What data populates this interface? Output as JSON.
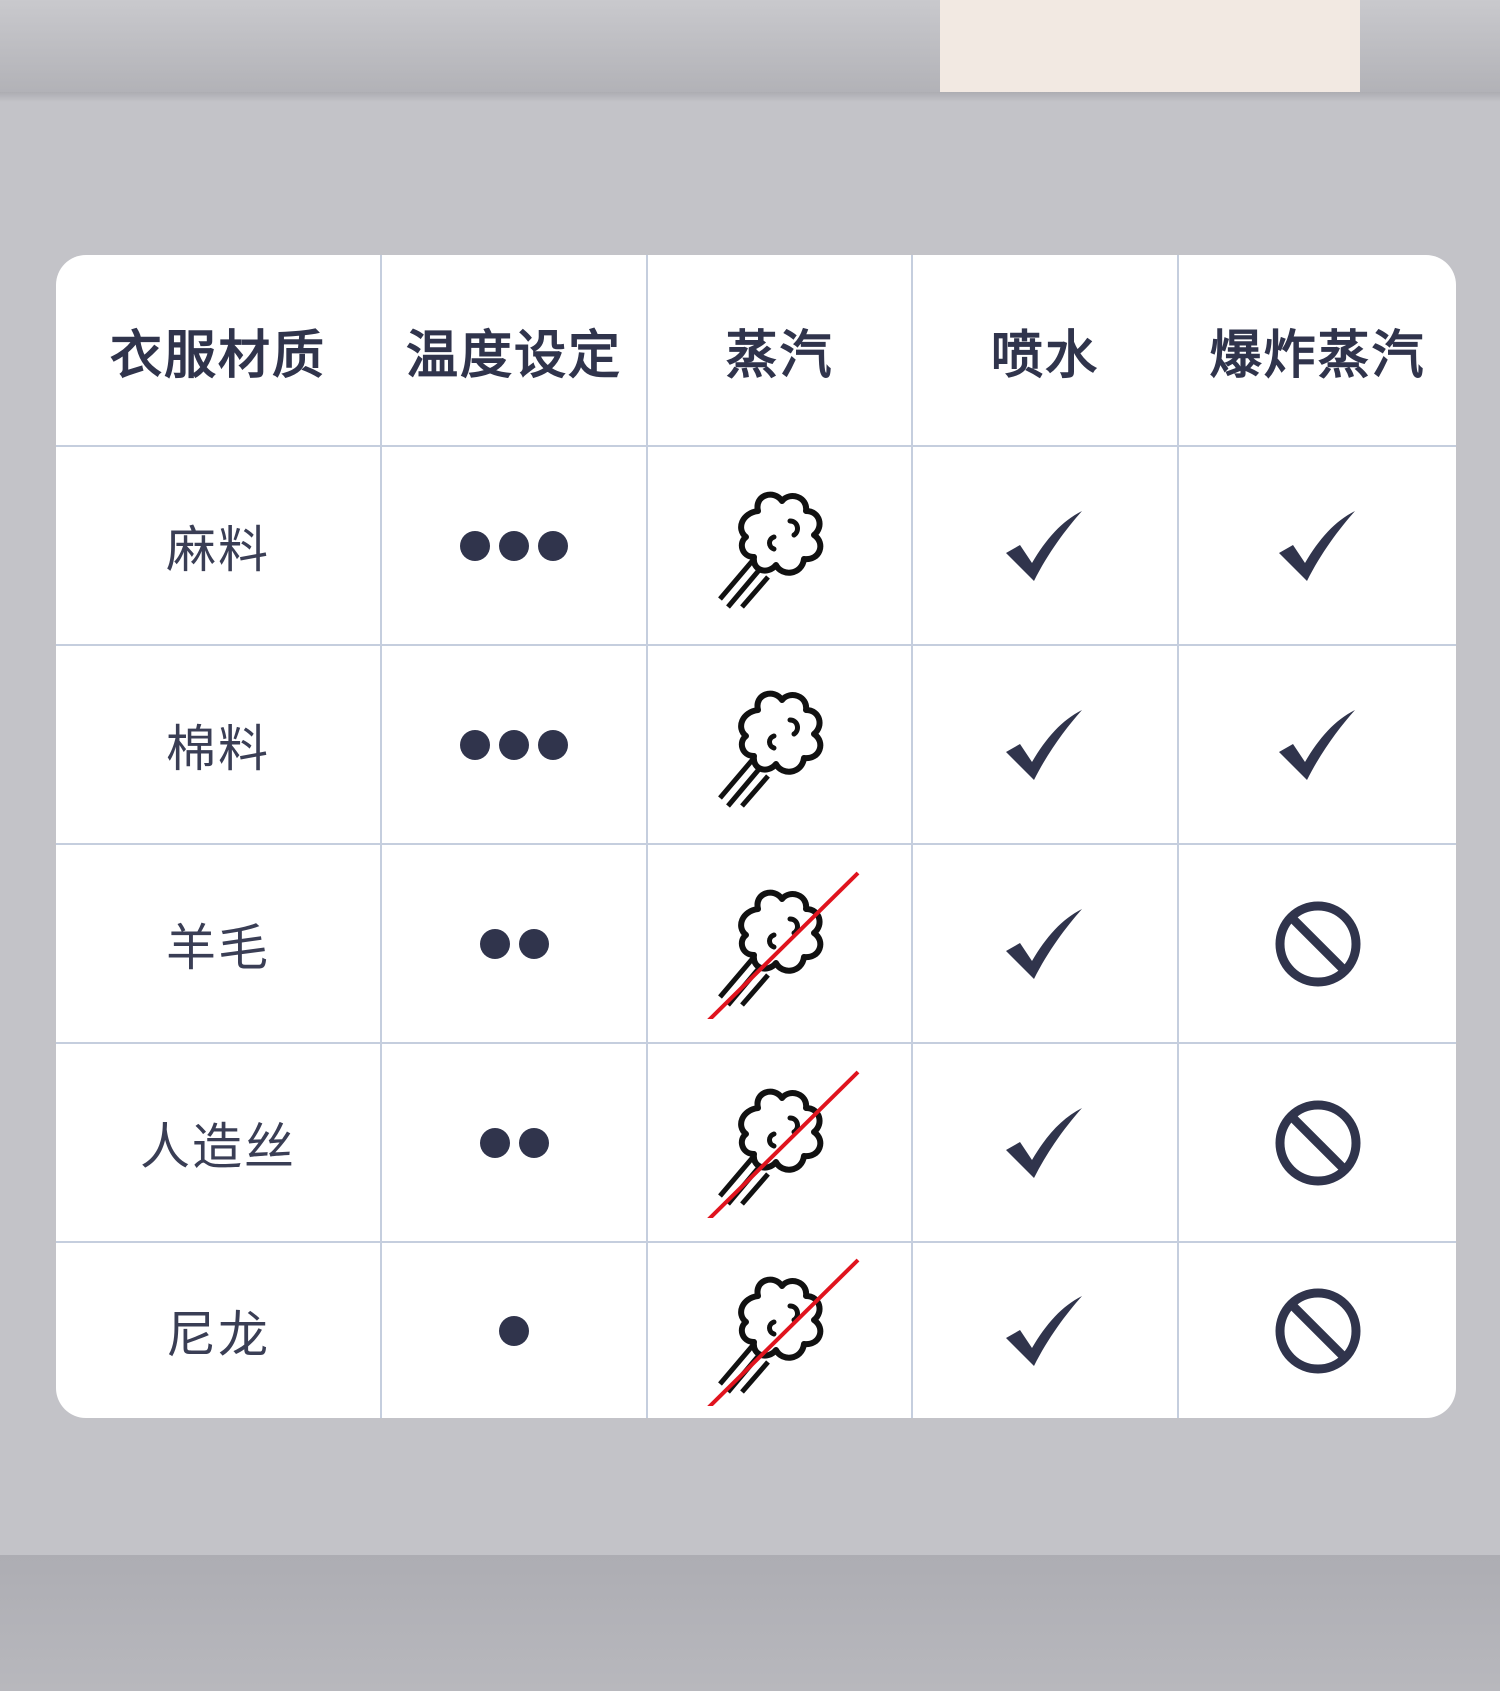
{
  "table": {
    "headers": [
      "衣服材质",
      "温度设定",
      "蒸汽",
      "喷水",
      "爆炸蒸汽"
    ],
    "rows": [
      {
        "material": "麻料",
        "temperature_dots": 3,
        "steam": "steam-icon",
        "spray": "check-icon",
        "burst_steam": "check-icon"
      },
      {
        "material": "棉料",
        "temperature_dots": 3,
        "steam": "steam-icon",
        "spray": "check-icon",
        "burst_steam": "check-icon"
      },
      {
        "material": "羊毛",
        "temperature_dots": 2,
        "steam": "steam-disabled-icon",
        "spray": "check-icon",
        "burst_steam": "prohibited-icon"
      },
      {
        "material": "人造丝",
        "temperature_dots": 2,
        "steam": "steam-disabled-icon",
        "spray": "check-icon",
        "burst_steam": "prohibited-icon"
      },
      {
        "material": "尼龙",
        "temperature_dots": 1,
        "steam": "steam-disabled-icon",
        "spray": "check-icon",
        "burst_steam": "prohibited-icon"
      }
    ]
  },
  "colors": {
    "background": "#c3c3c8",
    "card": "#ffffff",
    "grid_line": "#c5cede",
    "text": "#3a3e55",
    "icon": "#30344c",
    "slash": "#e0141e"
  }
}
